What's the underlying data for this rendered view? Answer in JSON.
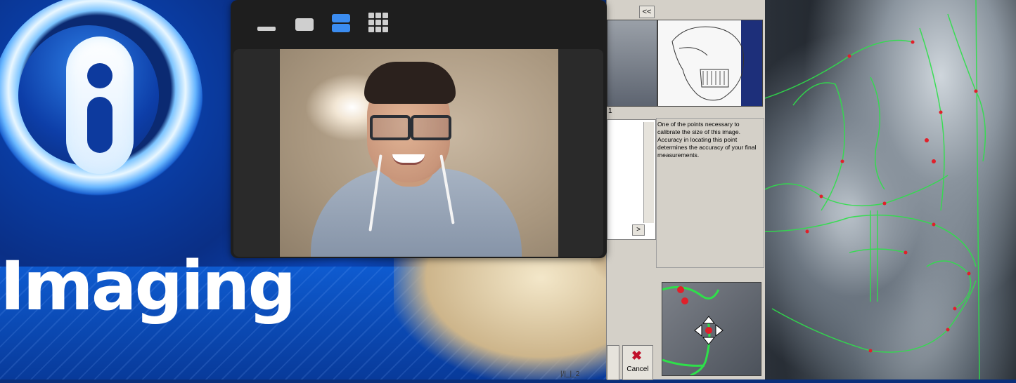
{
  "brand": {
    "word": "Imaging",
    "logo_icon": "info-i-logo"
  },
  "video_call": {
    "toolbar": [
      {
        "name": "minimize",
        "icon": "minimize-icon"
      },
      {
        "name": "single-view",
        "icon": "single-view-icon"
      },
      {
        "name": "split-view",
        "icon": "split-view-icon",
        "active": true
      },
      {
        "name": "grid-view",
        "icon": "grid-view-icon"
      }
    ],
    "accent": "#3b8cf0"
  },
  "dialog": {
    "collapse_label": "<<",
    "index_label": "1",
    "help_text": "One of the points necessary to calibrate the size of this image. Accuracy in locating this point determines the accuracy of your final measurements.",
    "scroll_right_label": ">",
    "cancel_label": "Cancel",
    "marks_label": "|/|_|_2"
  },
  "colors": {
    "trace_green": "#2ee04a",
    "landmark_red": "#e0202a"
  }
}
